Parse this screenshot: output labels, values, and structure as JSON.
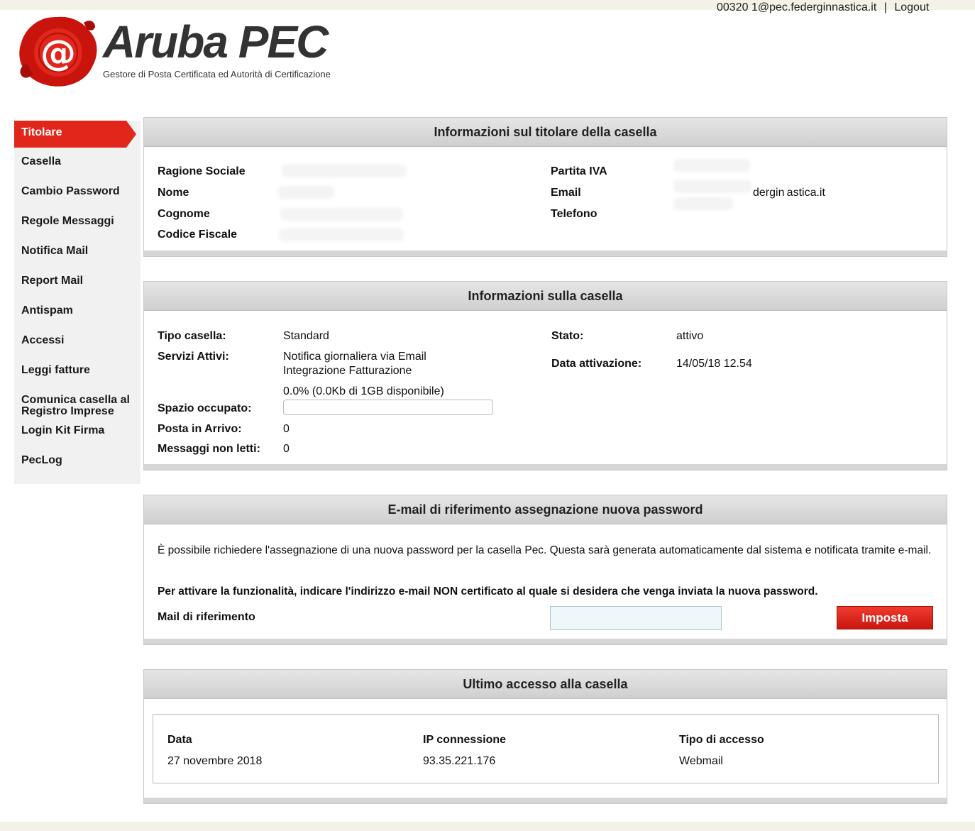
{
  "header": {
    "user_email": "00320 1@pec.federginnastica.it",
    "separator": "|",
    "logout_label": "Logout",
    "brand": "Aruba PEC",
    "tagline": "Gestore di Posta Certificata ed Autorità di Certificazione"
  },
  "colors": {
    "accent": "#e1261c",
    "header_bg": "#d9d9d9",
    "sidebar_bg": "#f1f1f1"
  },
  "sidebar": {
    "items": [
      {
        "label": "Titolare",
        "active": true
      },
      {
        "label": "Casella"
      },
      {
        "label": "Cambio Password"
      },
      {
        "label": "Regole Messaggi"
      },
      {
        "label": "Notifica Mail"
      },
      {
        "label": "Report Mail"
      },
      {
        "label": "Antispam"
      },
      {
        "label": "Accessi"
      },
      {
        "label": "Leggi fatture"
      },
      {
        "label": "Comunica casella al Registro Imprese"
      },
      {
        "label": "Login Kit Firma"
      },
      {
        "label": "PecLog"
      }
    ]
  },
  "titolare": {
    "title": "Informazioni sul titolare della casella",
    "ragione_sociale_label": "Ragione Sociale",
    "nome_label": "Nome",
    "cognome_label": "Cognome",
    "codice_fiscale_label": "Codice Fiscale",
    "partita_iva_label": "Partita IVA",
    "email_label": "Email",
    "email_value_visible": "dergin astica.it",
    "telefono_label": "Telefono"
  },
  "casella": {
    "title": "Informazioni sulla casella",
    "tipo_label": "Tipo casella:",
    "tipo_value": "Standard",
    "servizi_label": "Servizi Attivi:",
    "servizi_1": "Notifica giornaliera via Email",
    "servizi_2": "Integrazione Fatturazione",
    "spazio_text": "0.0% (0.0Kb di 1GB disponibile)",
    "spazio_label": "Spazio occupato:",
    "spazio_percent": 0.0,
    "posta_label": "Posta in Arrivo:",
    "posta_value": "0",
    "non_letti_label": "Messaggi non letti:",
    "non_letti_value": "0",
    "stato_label": "Stato:",
    "stato_value": "attivo",
    "data_attivazione_label": "Data attivazione:",
    "data_attivazione_value": "14/05/18 12.54"
  },
  "password_email": {
    "title": "E-mail di riferimento assegnazione nuova password",
    "description": "È possibile richiedere l'assegnazione di una nuova password per la casella Pec. Questa sarà generata automaticamente dal sistema e notificata tramite e-mail.",
    "instruction": "Per attivare la funzionalità, indicare l'indirizzo e-mail NON certificato al quale si desidera che venga inviata la nuova password.",
    "field_label": "Mail di riferimento",
    "field_value": "",
    "button_label": "Imposta"
  },
  "ultimo_accesso": {
    "title": "Ultimo accesso alla casella",
    "col_data": "Data",
    "col_ip": "IP connessione",
    "col_tipo": "Tipo di accesso",
    "data": "27 novembre 2018",
    "ip": "93.35.221.176",
    "tipo": "Webmail"
  }
}
